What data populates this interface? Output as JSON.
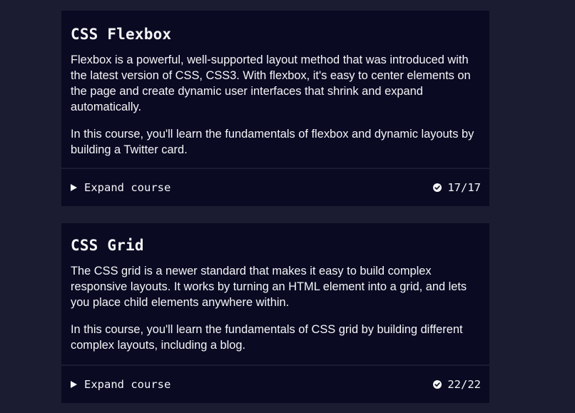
{
  "courses": [
    {
      "title": "CSS Flexbox",
      "paragraphs": [
        "Flexbox is a powerful, well-supported layout method that was introduced with the latest version of CSS, CSS3. With flexbox, it's easy to center elements on the page and create dynamic user interfaces that shrink and expand automatically.",
        "In this course, you'll learn the fundamentals of flexbox and dynamic layouts by building a Twitter card."
      ],
      "expand_label": "Expand course",
      "expand_icon": "triangle-right-icon",
      "progress": "17/17",
      "progress_icon": "check-circle-icon"
    },
    {
      "title": "CSS Grid",
      "paragraphs": [
        "The CSS grid is a newer standard that makes it easy to build complex responsive layouts. It works by turning an HTML element into a grid, and lets you place child elements anywhere within.",
        "In this course, you'll learn the fundamentals of CSS grid by building different complex layouts, including a blog."
      ],
      "expand_label": "Expand course",
      "expand_icon": "triangle-right-icon",
      "progress": "22/22",
      "progress_icon": "check-circle-icon"
    }
  ],
  "colors": {
    "background": "#1b1b32",
    "card": "#0a0a23",
    "text": "#f5f6f7"
  }
}
